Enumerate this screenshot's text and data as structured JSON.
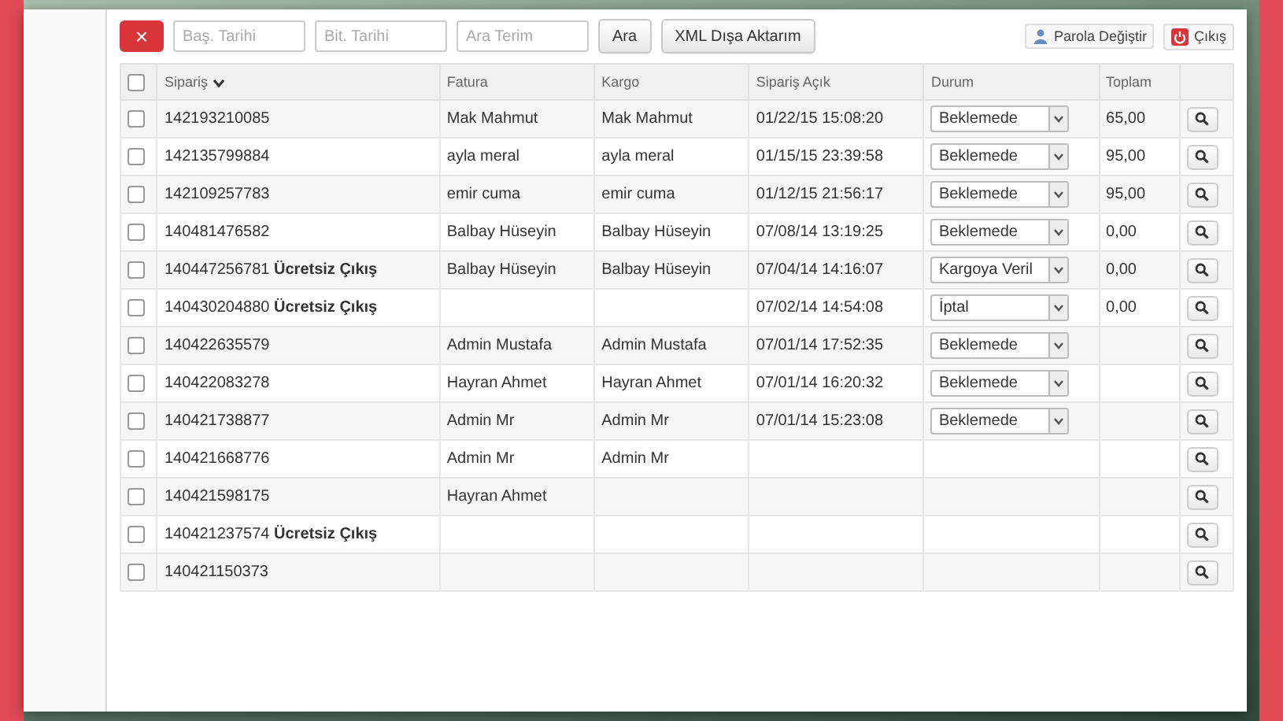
{
  "toolbar": {
    "delete_button": {
      "label": "×"
    },
    "fields": [
      {
        "placeholder": "Baş. Tarihi"
      },
      {
        "placeholder": "Bit. Tarihi"
      },
      {
        "placeholder": "Ara Terim"
      }
    ],
    "buttons": [
      "Ara",
      "XML Dışa Aktarım"
    ],
    "links": [
      {
        "kind": "password",
        "label": "Parola Değiştir"
      },
      {
        "kind": "logout",
        "label": "Çıkış"
      }
    ]
  },
  "table": {
    "header_checkbox": {
      "checked": false
    },
    "columns": [
      "Sipariş",
      "Fatura",
      "Kargo",
      "Sipariş Açık",
      "Durum",
      "Toplam"
    ],
    "rows": [
      {
        "checked": false,
        "order": "142193210085",
        "billing": "Mak Mahmut",
        "shipping": "Mak Mahmut",
        "opened": "01/22/15 15:08:20",
        "status": "Beklemede",
        "total": "65,00"
      },
      {
        "checked": false,
        "order": "142135799884",
        "billing": "ayla meral",
        "shipping": "ayla meral",
        "opened": "01/15/15 23:39:58",
        "status": "Beklemede",
        "total": "95,00"
      },
      {
        "checked": false,
        "order": "142109257783",
        "billing": "emir cuma",
        "shipping": "emir cuma",
        "opened": "01/12/15 21:56:17",
        "status": "Beklemede",
        "total": "95,00"
      },
      {
        "checked": false,
        "order": "140481476582",
        "billing": "Balbay Hüseyin",
        "shipping": "Balbay Hüseyin",
        "opened": "07/08/14 13:19:25",
        "status": "Beklemede",
        "total": "0,00"
      },
      {
        "checked": false,
        "order": "140447256781 **Ücretsiz Çıkış**",
        "billing": "Balbay Hüseyin",
        "shipping": "Balbay Hüseyin",
        "opened": "07/04/14 14:16:07",
        "status": "Kargoya Veril",
        "total": "0,00"
      },
      {
        "checked": false,
        "order": "140430204880 **Ücretsiz Çıkış**",
        "opened": "07/02/14 14:54:08",
        "status": "İptal",
        "total": "0,00"
      },
      {
        "checked": false,
        "order": "140422635579",
        "billing": "Admin Mustafa",
        "shipping": "Admin Mustafa",
        "opened": "07/01/14 17:52:35",
        "status": "Beklemede"
      },
      {
        "checked": false,
        "order": "140422083278",
        "billing": "Hayran Ahmet",
        "shipping": "Hayran Ahmet",
        "opened": "07/01/14 16:20:32",
        "status": "Beklemede"
      },
      {
        "checked": false,
        "order": "140421738877",
        "billing": "Admin Mr",
        "shipping": "Admin Mr",
        "opened": "07/01/14 15:23:08",
        "status": "Beklemede"
      },
      {
        "checked": false,
        "order": "140421668776",
        "billing": "Admin Mr",
        "shipping": "Admin Mr"
      },
      {
        "checked": false,
        "order": "140421598175",
        "billing": "Hayran Ahmet"
      },
      {
        "checked": false,
        "order": "140421237574 **Ücretsiz Çıkış**"
      },
      {
        "checked": false,
        "order": "140421150373"
      }
    ]
  }
}
